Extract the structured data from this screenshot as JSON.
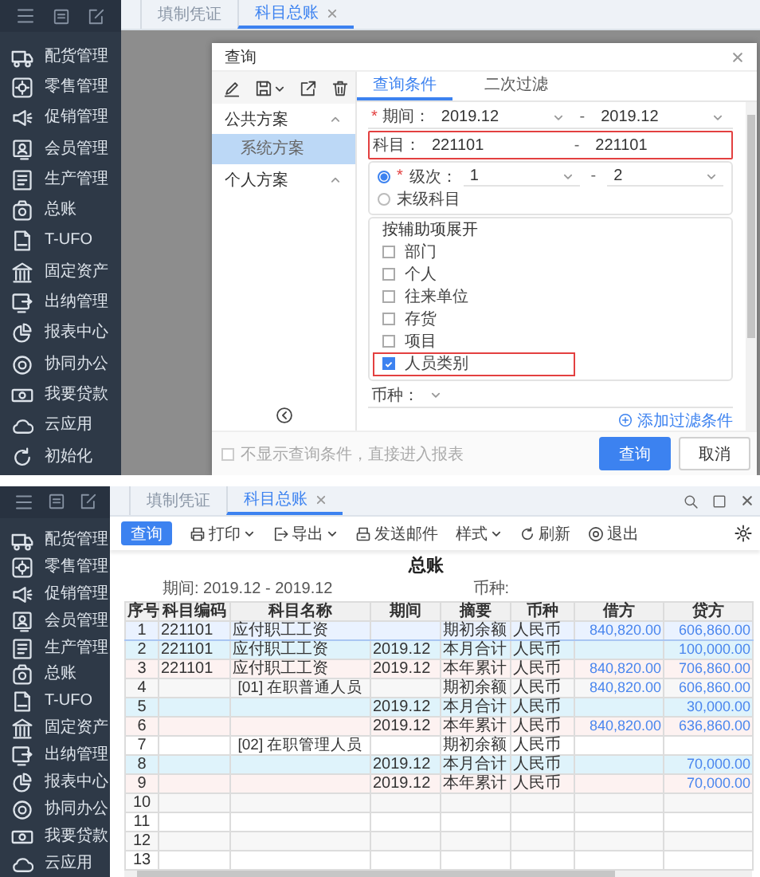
{
  "query_screen": {
    "sidebar": {
      "items": [
        {
          "kind": "delivery",
          "label": "配货管理"
        },
        {
          "kind": "retail",
          "label": "零售管理"
        },
        {
          "kind": "promotion",
          "label": "促销管理"
        },
        {
          "kind": "member",
          "label": "会员管理"
        },
        {
          "kind": "production",
          "label": "生产管理"
        },
        {
          "kind": "ledger",
          "label": "总账"
        },
        {
          "kind": "ufo",
          "label": "T-UFO"
        },
        {
          "kind": "assets",
          "label": "固定资产"
        },
        {
          "kind": "cashier",
          "label": "出纳管理"
        },
        {
          "kind": "reports",
          "label": "报表中心"
        },
        {
          "kind": "collaboration",
          "label": "协同办公"
        },
        {
          "kind": "loan",
          "label": "我要贷款"
        },
        {
          "kind": "cloud",
          "label": "云应用"
        },
        {
          "kind": "init",
          "label": "初始化"
        }
      ]
    },
    "tabs": [
      {
        "label": "填制凭证",
        "selected": false,
        "closable": false
      },
      {
        "label": "科目总账",
        "selected": true,
        "closable": true
      }
    ],
    "dialog": {
      "title": "查询",
      "toolbar": [
        {
          "kind": "edit",
          "dropdown": false
        },
        {
          "kind": "save",
          "dropdown": true
        },
        {
          "kind": "export",
          "dropdown": false
        },
        {
          "kind": "delete",
          "dropdown": false
        }
      ],
      "schemes": [
        {
          "label": "公共方案",
          "expanded": true,
          "children": [
            {
              "label": "系统方案",
              "selected": true
            }
          ]
        },
        {
          "label": "个人方案",
          "expanded": true
        }
      ],
      "tabs": [
        {
          "label": "查询条件",
          "selected": true
        },
        {
          "label": "二次过滤",
          "selected": false
        }
      ],
      "period": {
        "required_mark": "*",
        "label": "期间：",
        "from": "2019.12",
        "separator": "-",
        "to": "2019.12"
      },
      "account": {
        "label": "科目：",
        "from": "221101",
        "separator": "-",
        "to": "221101",
        "highlighted": true
      },
      "level_options": [
        {
          "kind": "range",
          "selected": true,
          "required_mark": "*",
          "label": "级次：",
          "from": "1",
          "separator": "-",
          "to": "2"
        },
        {
          "kind": "plain",
          "selected": false,
          "label": "末级科目"
        }
      ],
      "aux_expand": {
        "title": "按辅助项展开",
        "options": [
          {
            "label": "部门",
            "checked": false,
            "highlighted": false
          },
          {
            "label": "个人",
            "checked": false,
            "highlighted": false
          },
          {
            "label": "往来单位",
            "checked": false,
            "highlighted": false
          },
          {
            "label": "存货",
            "checked": false,
            "highlighted": false
          },
          {
            "label": "项目",
            "checked": false,
            "highlighted": false
          },
          {
            "label": "人员类别",
            "checked": true,
            "highlighted": true
          }
        ]
      },
      "currency": {
        "label": "币种："
      },
      "add_filter": "添加过滤条件",
      "skip_option": {
        "label": "不显示查询条件，直接进入报表",
        "checked": false
      },
      "buttons": [
        {
          "kind": "primary",
          "label": "查询"
        },
        {
          "kind": "secondary",
          "label": "取消"
        }
      ]
    }
  },
  "ledger_screen": {
    "sidebar": {
      "items": [
        {
          "kind": "delivery",
          "label": "配货管理"
        },
        {
          "kind": "retail",
          "label": "零售管理"
        },
        {
          "kind": "promotion",
          "label": "促销管理"
        },
        {
          "kind": "member",
          "label": "会员管理"
        },
        {
          "kind": "production",
          "label": "生产管理"
        },
        {
          "kind": "ledger",
          "label": "总账"
        },
        {
          "kind": "ufo",
          "label": "T-UFO"
        },
        {
          "kind": "assets",
          "label": "固定资产"
        },
        {
          "kind": "cashier",
          "label": "出纳管理"
        },
        {
          "kind": "reports",
          "label": "报表中心"
        },
        {
          "kind": "collaboration",
          "label": "协同办公"
        },
        {
          "kind": "loan",
          "label": "我要贷款"
        },
        {
          "kind": "cloud",
          "label": "云应用"
        }
      ]
    },
    "tabs": [
      {
        "label": "填制凭证",
        "selected": false,
        "closable": false
      },
      {
        "label": "科目总账",
        "selected": true,
        "closable": true
      }
    ],
    "toolbar": {
      "query_button": "查询",
      "tools": [
        {
          "kind": "print",
          "label": "打印",
          "dropdown": true
        },
        {
          "kind": "export",
          "label": "导出",
          "dropdown": true
        },
        {
          "kind": "mail",
          "label": "发送邮件",
          "dropdown": false
        },
        {
          "kind": "style",
          "label": "样式",
          "dropdown": true
        },
        {
          "kind": "refresh",
          "label": "刷新",
          "dropdown": false
        },
        {
          "kind": "exit",
          "label": "退出",
          "dropdown": false
        }
      ]
    },
    "report": {
      "title": "总账",
      "period_label": "期间:",
      "period": "2019.12 - 2019.12",
      "currency_label": "币种:",
      "columns": [
        "序号",
        "科目编码",
        "科目名称",
        "期间",
        "摘要",
        "币种",
        "借方",
        "贷方"
      ],
      "rows": [
        {
          "kind": "opening",
          "selected": true,
          "no": "1",
          "code": "221101",
          "name": "应付职工工资",
          "summary": "期初余额",
          "currency": "人民币",
          "debit": "840,820.00",
          "credit": "606,860.00"
        },
        {
          "kind": "month",
          "selected": false,
          "no": "2",
          "code": "221101",
          "name": "应付职工工资",
          "period": "2019.12",
          "summary": "本月合计",
          "currency": "人民币",
          "credit": "100,000.00"
        },
        {
          "kind": "year",
          "selected": false,
          "no": "3",
          "code": "221101",
          "name": "应付职工工资",
          "period": "2019.12",
          "summary": "本年累计",
          "currency": "人民币",
          "debit": "840,820.00",
          "credit": "706,860.00"
        },
        {
          "kind": "aux_opening",
          "selected": false,
          "no": "4",
          "name": "[01] 在职普通人员",
          "summary": "期初余额",
          "currency": "人民币",
          "debit": "840,820.00",
          "credit": "606,860.00"
        },
        {
          "kind": "month",
          "selected": false,
          "no": "5",
          "period": "2019.12",
          "summary": "本月合计",
          "currency": "人民币",
          "credit": "30,000.00"
        },
        {
          "kind": "year",
          "selected": false,
          "no": "6",
          "period": "2019.12",
          "summary": "本年累计",
          "currency": "人民币",
          "debit": "840,820.00",
          "credit": "636,860.00"
        },
        {
          "kind": "aux_opening",
          "selected": false,
          "no": "7",
          "name": "[02] 在职管理人员",
          "summary": "期初余额",
          "currency": "人民币"
        },
        {
          "kind": "month",
          "selected": false,
          "no": "8",
          "period": "2019.12",
          "summary": "本月合计",
          "currency": "人民币",
          "credit": "70,000.00"
        },
        {
          "kind": "year",
          "selected": false,
          "no": "9",
          "period": "2019.12",
          "summary": "本年累计",
          "currency": "人民币",
          "credit": "70,000.00"
        },
        {
          "kind": "empty",
          "selected": false,
          "no": "10"
        },
        {
          "kind": "empty",
          "selected": false,
          "no": "11"
        },
        {
          "kind": "empty",
          "selected": false,
          "no": "12"
        },
        {
          "kind": "empty",
          "selected": false,
          "no": "13"
        }
      ]
    }
  }
}
